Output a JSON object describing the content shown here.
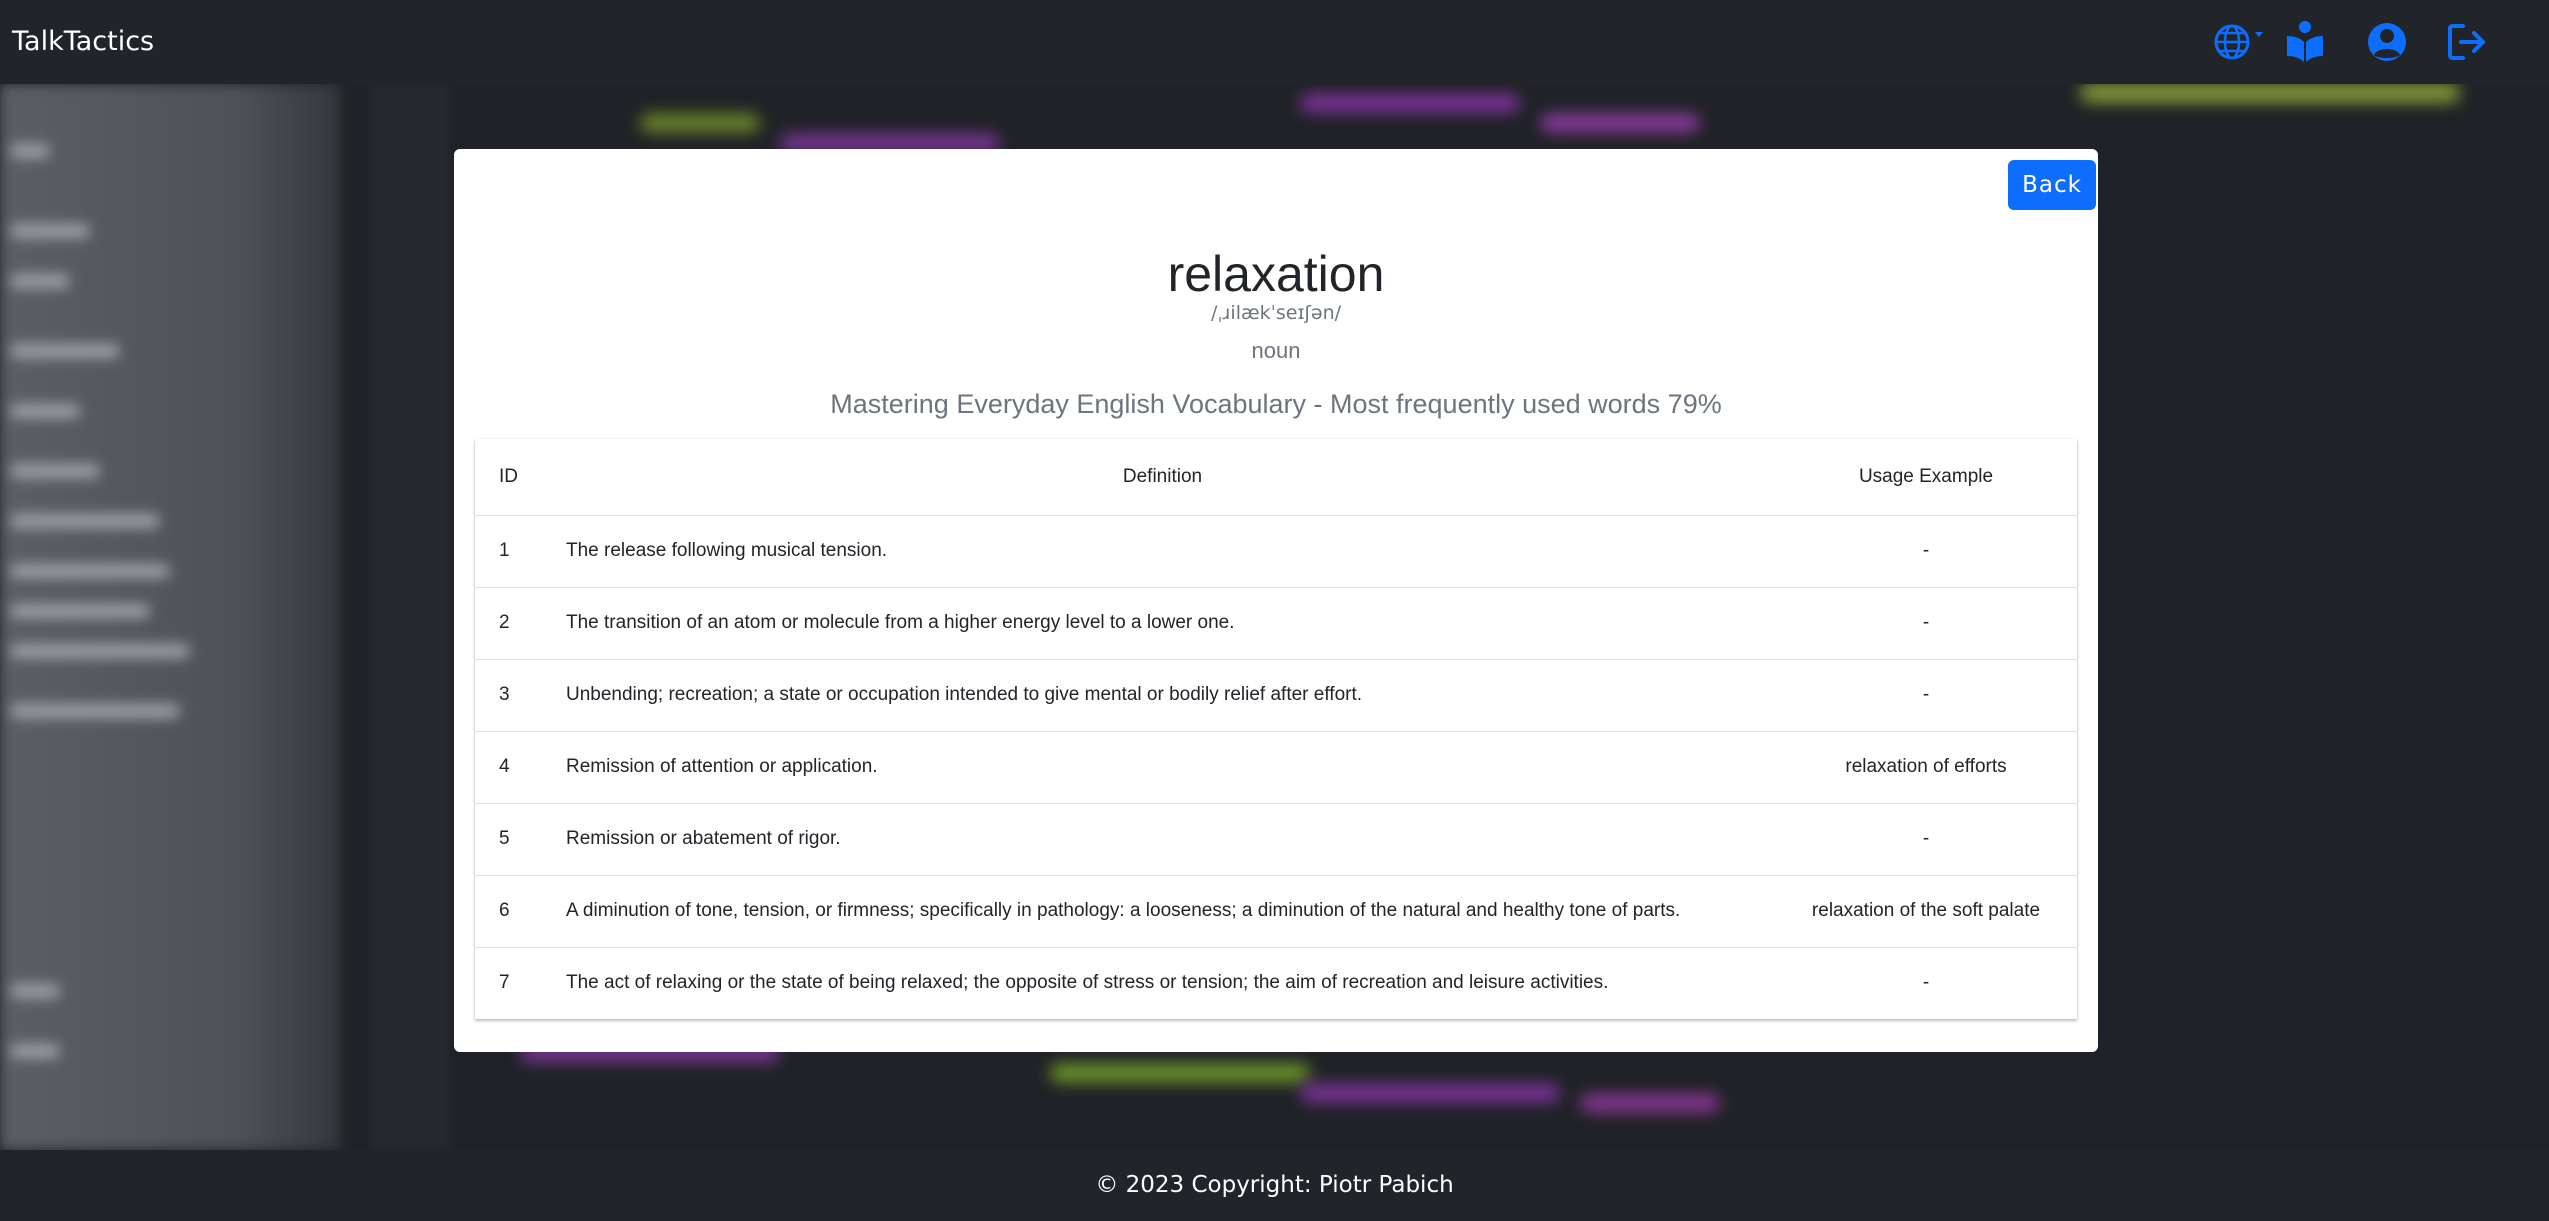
{
  "app": {
    "brand": "TalkTactics"
  },
  "nav": {
    "icons": [
      "globe-icon",
      "book-reader-icon",
      "user-circle-icon",
      "logout-icon"
    ],
    "accent": "#0d6efd"
  },
  "card": {
    "back_label": "Back",
    "word": "relaxation",
    "phonetic": "/ˌɹilækˈseɪʃən/",
    "part_of_speech": "noun",
    "collection": "Mastering Everyday English Vocabulary - Most frequently used words 79%"
  },
  "table": {
    "headers": {
      "id": "ID",
      "definition": "Definition",
      "example": "Usage Example"
    },
    "rows": [
      {
        "id": "1",
        "definition": "The release following musical tension.",
        "example": "-"
      },
      {
        "id": "2",
        "definition": "The transition of an atom or molecule from a higher energy level to a lower one.",
        "example": "-"
      },
      {
        "id": "3",
        "definition": "Unbending; recreation; a state or occupation intended to give mental or bodily relief after effort.",
        "example": "-"
      },
      {
        "id": "4",
        "definition": "Remission of attention or application.",
        "example": "relaxation of efforts"
      },
      {
        "id": "5",
        "definition": "Remission or abatement of rigor.",
        "example": "-"
      },
      {
        "id": "6",
        "definition": "A diminution of tone, tension, or firmness; specifically in pathology: a looseness; a diminution of the natural and healthy tone of parts.",
        "example": "relaxation of the soft palate"
      },
      {
        "id": "7",
        "definition": "The act of relaxing or the state of being relaxed; the opposite of stress or tension; the aim of recreation and leisure activities.",
        "example": "-"
      }
    ]
  },
  "footer": {
    "text": "© 2023 Copyright: Piotr Pabich"
  }
}
